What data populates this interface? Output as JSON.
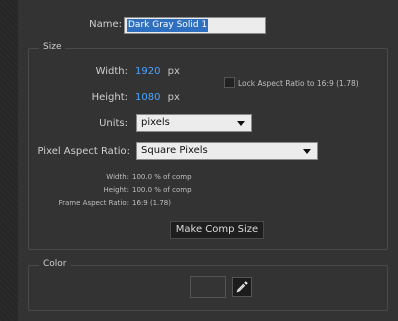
{
  "name": {
    "label": "Name:",
    "value": "Dark Gray Solid 1"
  },
  "size": {
    "title": "Size",
    "width": {
      "label": "Width:",
      "value": "1920",
      "unit": "px"
    },
    "height": {
      "label": "Height:",
      "value": "1080",
      "unit": "px"
    },
    "lock_aspect": {
      "label": "Lock Aspect Ratio to 16:9 (1.78)",
      "checked": false
    },
    "units": {
      "label": "Units:",
      "value": "pixels"
    },
    "pixel_aspect": {
      "label": "Pixel Aspect Ratio:",
      "value": "Square Pixels"
    },
    "info": {
      "width_label": "Width:",
      "width_value": "100.0 % of comp",
      "height_label": "Height:",
      "height_value": "100.0 % of comp",
      "frame_label": "Frame Aspect Ratio:",
      "frame_value": "16:9 (1.78)"
    },
    "make_comp_button": "Make Comp Size"
  },
  "color": {
    "title": "Color",
    "swatch": "#343434"
  },
  "icons": {
    "eyedropper": "eyedropper-icon"
  }
}
